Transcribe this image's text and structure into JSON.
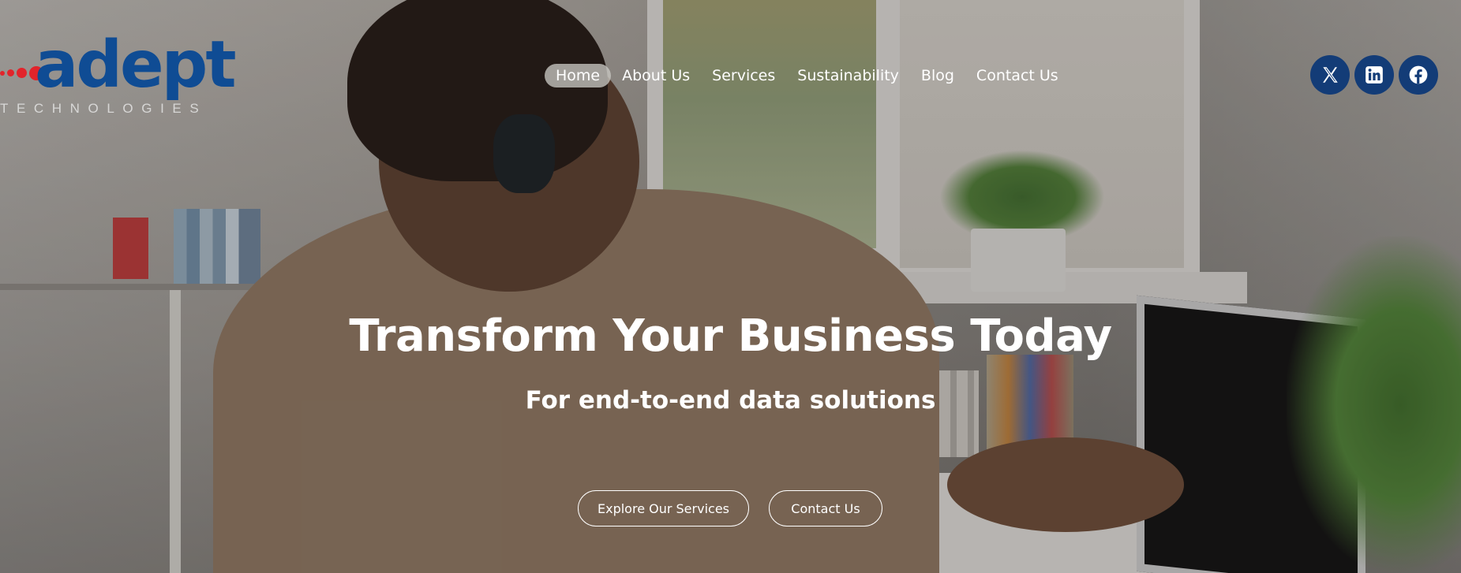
{
  "brand": {
    "name": "adept",
    "tagline": "TECHNOLOGIES",
    "primary_color": "#0f4c94",
    "accent_color": "#e2242b"
  },
  "nav": {
    "items": [
      {
        "label": "Home",
        "active": true
      },
      {
        "label": "About Us",
        "active": false
      },
      {
        "label": "Services",
        "active": false
      },
      {
        "label": "Sustainability",
        "active": false
      },
      {
        "label": "Blog",
        "active": false
      },
      {
        "label": "Contact Us",
        "active": false
      }
    ]
  },
  "social": {
    "icons": [
      "x-twitter-icon",
      "linkedin-icon",
      "facebook-icon"
    ],
    "color": "#133c77"
  },
  "hero": {
    "headline": "Transform Your Business Today",
    "subheadline": "For end-to-end data solutions",
    "buttons": {
      "primary": "Explore Our Services",
      "secondary": "Contact Us"
    }
  }
}
